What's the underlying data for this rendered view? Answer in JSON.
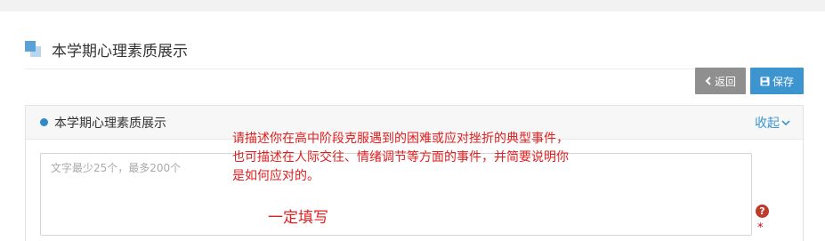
{
  "section": {
    "title": "本学期心理素质展示"
  },
  "toolbar": {
    "back_label": "返回",
    "save_label": "保存"
  },
  "panel": {
    "title": "本学期心理素质展示",
    "collapse_label": "收起",
    "textarea_placeholder": "文字最少25个，最多200个",
    "textarea_value": "",
    "help_glyph": "?",
    "required_mark": "*"
  },
  "annotations": {
    "lines": [
      "请描述你在高中阶段克服遇到的困难或应对挫折的典型事件，",
      "也可描述在人际交往、情绪调节等方面的事件，并简要说明你",
      "是如何应对的。"
    ],
    "emphasis": "一定填写"
  },
  "colors": {
    "accent": "#3c95cf",
    "back_button": "#8f8f8f",
    "annotation": "#e02020",
    "required": "#d0021b"
  },
  "icons": {
    "section": "stacked-squares-icon",
    "back": "chevron-left-icon",
    "save": "floppy-disk-icon",
    "collapse": "chevron-down-icon",
    "help": "question-circle-icon",
    "panel_bullet": "dot-icon"
  }
}
